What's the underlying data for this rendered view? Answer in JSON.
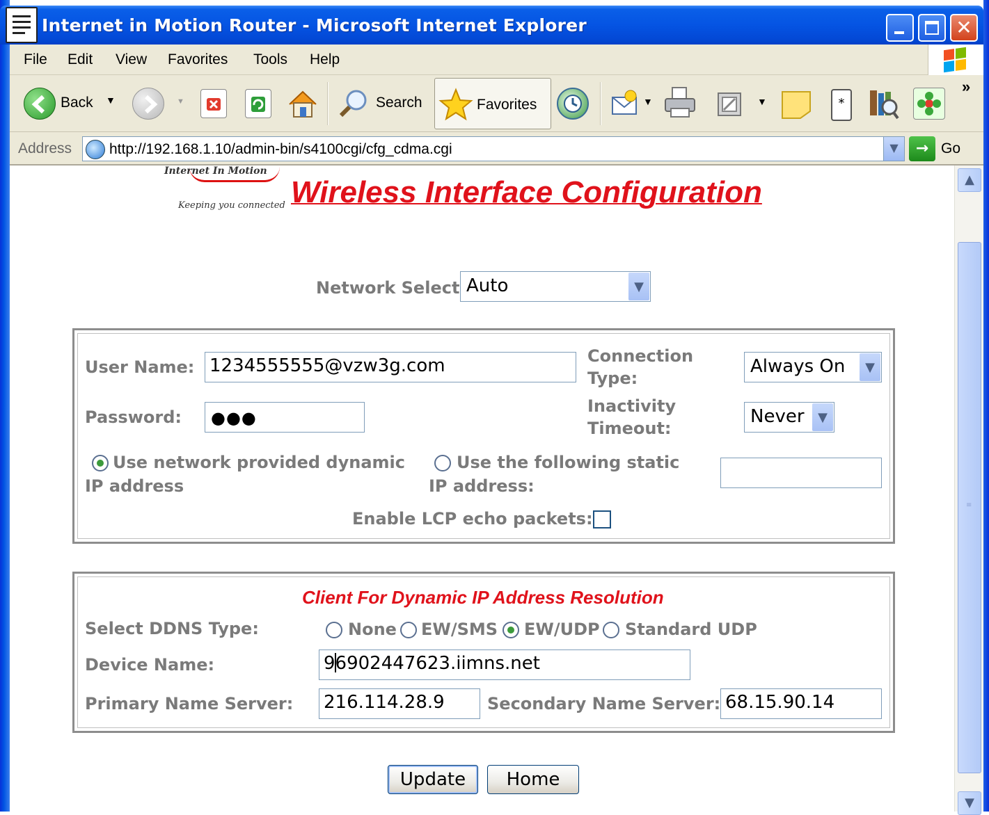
{
  "window": {
    "title": "Internet in Motion Router - Microsoft Internet Explorer",
    "min_glyph": "",
    "close_glyph": "✕"
  },
  "menu": {
    "items": [
      "File",
      "Edit",
      "View",
      "Favorites",
      "Tools",
      "Help"
    ]
  },
  "toolbar": {
    "back_label": "Back",
    "search_label": "Search",
    "favorites_label": "Favorites",
    "more_glyph": "»"
  },
  "address": {
    "label": "Address",
    "url": "http://192.168.1.10/admin-bin/s4100cgi/cfg_cdma.cgi",
    "go_label": "Go"
  },
  "page": {
    "logo_top": "Internet In Motion",
    "logo_tagline": "Keeping you connected",
    "title": "Wireless Interface Configuration",
    "network_select": {
      "label": "Network Select:",
      "value": "Auto"
    },
    "connection": {
      "user_name_label": "User Name:",
      "user_name_value": "1234555555@vzw3g.com",
      "password_label": "Password:",
      "password_mask": "●●●",
      "connection_type_label": "Connection Type:",
      "connection_type_value": "Always On",
      "inactivity_label": "Inactivity Timeout:",
      "inactivity_value": "Never",
      "dynamic_ip_label": "Use network provided dynamic IP address",
      "dynamic_ip_selected": true,
      "static_ip_label": "Use the following static IP address:",
      "static_ip_value": "",
      "lcp_label": "Enable LCP echo packets:",
      "lcp_checked": false
    },
    "ddns": {
      "title": "Client For Dynamic IP Address Resolution",
      "type_label": "Select DDNS Type:",
      "options": [
        "None",
        "EW/SMS",
        "EW/UDP",
        "Standard UDP"
      ],
      "selected": "EW/UDP",
      "device_name_label": "Device Name:",
      "device_name_value_pre": "9",
      "device_name_value_post": "6902447623.iimns.net",
      "primary_label": "Primary Name Server:",
      "primary_value": "216.114.28.9",
      "secondary_label": "Secondary Name Server:",
      "secondary_value": "68.15.90.14"
    },
    "buttons": {
      "update": "Update",
      "home": "Home"
    }
  },
  "colors": {
    "title_red": "#e0121b",
    "label_gray": "#7a7a7a",
    "xp_blue": "#0554e3"
  }
}
